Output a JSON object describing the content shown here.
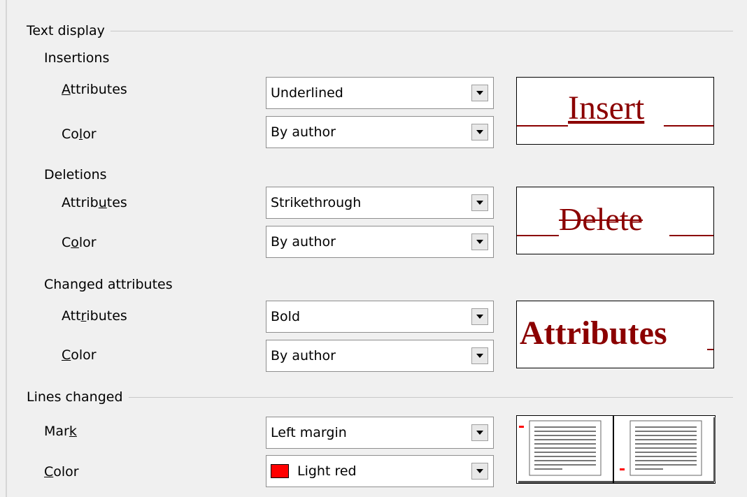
{
  "text_display": {
    "heading": "Text display",
    "insertions": {
      "heading": "Insertions",
      "attributes_label_u": "A",
      "attributes_label_rest": "ttributes",
      "attributes_value": "Underlined",
      "color_label_pre": "Co",
      "color_label_u": "l",
      "color_label_post": "or",
      "color_value": "By author",
      "preview_text": "Insert"
    },
    "deletions": {
      "heading": "Deletions",
      "attributes_label_pre": "Attrib",
      "attributes_label_u": "u",
      "attributes_label_post": "tes",
      "attributes_value": "Strikethrough",
      "color_label_pre": "C",
      "color_label_u": "o",
      "color_label_post": "lor",
      "color_value": "By author",
      "preview_text": "Delete"
    },
    "changed_attributes": {
      "heading": "Changed attributes",
      "attributes_label_pre": "Att",
      "attributes_label_u": "r",
      "attributes_label_post": "ibutes",
      "attributes_value": "Bold",
      "color_label_u": "C",
      "color_label_post": "olor",
      "color_value": "By author",
      "preview_text": "Attributes"
    }
  },
  "lines_changed": {
    "heading": "Lines changed",
    "mark_label_pre": "Mar",
    "mark_label_u": "k",
    "mark_value": "Left margin",
    "color_label_u": "C",
    "color_label_post": "olor",
    "color_value": "Light red",
    "color_swatch": "#ff0000"
  },
  "colors": {
    "preview_text": "#8b0000",
    "mark": "#ff0000"
  }
}
